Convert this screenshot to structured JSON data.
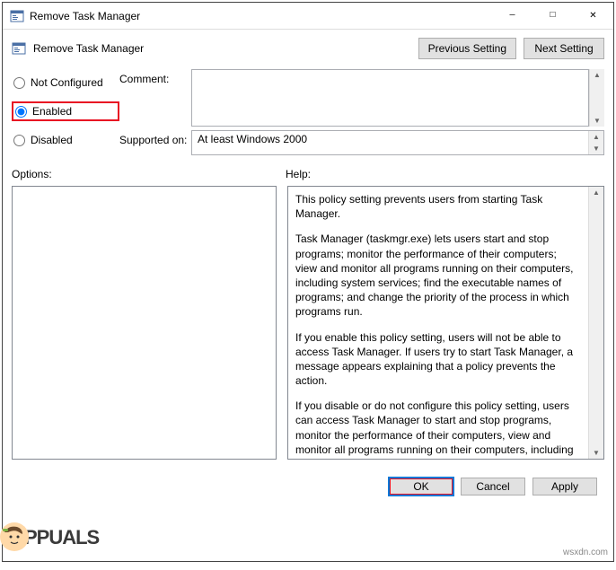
{
  "window": {
    "title": "Remove Task Manager"
  },
  "toolbar": {
    "title": "Remove Task Manager",
    "prev_label": "Previous Setting",
    "next_label": "Next Setting"
  },
  "radio": {
    "not_configured": "Not Configured",
    "enabled": "Enabled",
    "disabled": "Disabled",
    "selected": "enabled"
  },
  "fields": {
    "comment_label": "Comment:",
    "comment_value": "",
    "supported_label": "Supported on:",
    "supported_value": "At least Windows 2000"
  },
  "mid": {
    "options_label": "Options:",
    "help_label": "Help:"
  },
  "help": {
    "p1": "This policy setting prevents users from starting Task Manager.",
    "p2": "Task Manager (taskmgr.exe) lets users start and stop programs; monitor the performance of their computers; view and monitor all programs running on their computers, including system services; find the executable names of programs; and change the priority of the process in which programs run.",
    "p3": "If you enable this policy setting, users will not be able to access Task Manager. If users try to start Task Manager, a message appears explaining that a policy prevents the action.",
    "p4": "If you disable or do not configure this policy setting, users can access Task Manager to  start and stop programs, monitor the performance of their computers, view and monitor all programs running on their computers, including system services, find the executable names of programs, and change the priority of the process in which programs run."
  },
  "buttons": {
    "ok": "OK",
    "cancel": "Cancel",
    "apply": "Apply"
  },
  "watermark": {
    "text": "PPUALS",
    "source": "wsxdn.com"
  }
}
